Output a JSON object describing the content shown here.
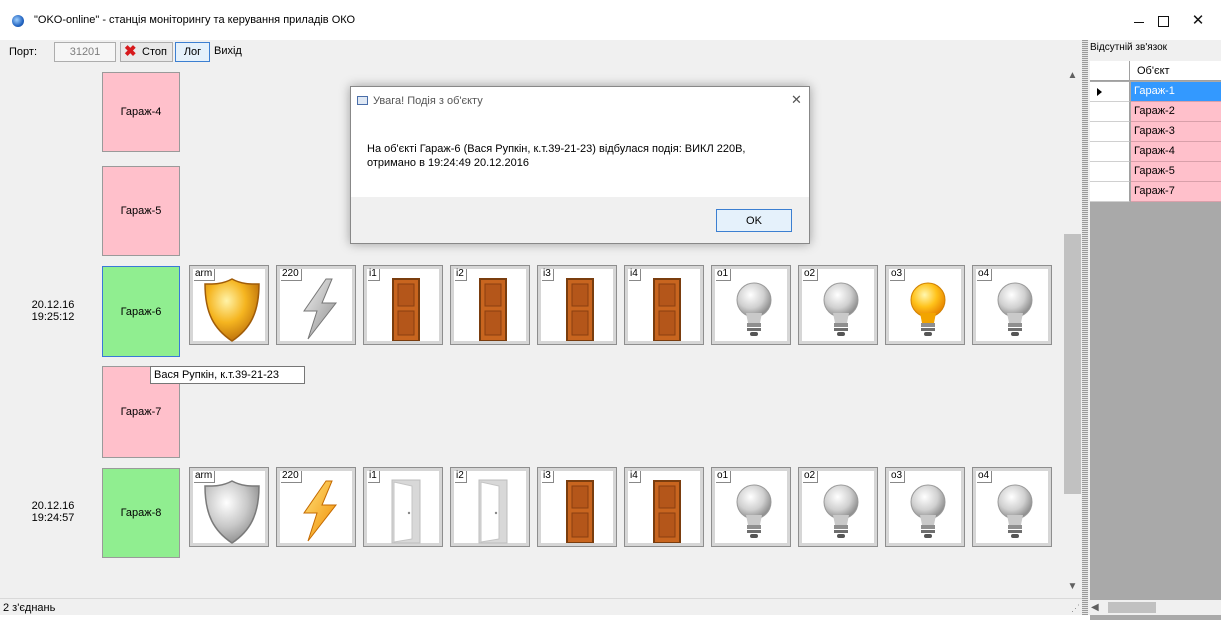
{
  "window": {
    "title": "\"OKO-online\" - станція моніторингу та керування приладів ОКО",
    "icons": {
      "app": "globe-app-icon",
      "minimize": "minimize-icon",
      "maximize": "maximize-icon",
      "close": "close-icon"
    }
  },
  "toolbar": {
    "port_label": "Порт:",
    "port_value": "31201",
    "stop_label": "Стоп",
    "log_label": "Лог",
    "exit_label": "Вихід",
    "stop_icon": "red-x-icon"
  },
  "objects": {
    "g4": {
      "name": "Гараж-4",
      "color": "#ffc0cb"
    },
    "g5": {
      "name": "Гараж-5",
      "color": "#ffc0cb"
    },
    "g6": {
      "name": "Гараж-6",
      "color": "#90ee90",
      "date": "20.12.16",
      "time": "19:25:12",
      "tooltip": "Вася Рупкін, к.т.39-21-23",
      "sensors": [
        {
          "label": "arm",
          "icon": "shield-gold-icon"
        },
        {
          "label": "220",
          "icon": "lightning-gray-icon"
        },
        {
          "label": "i1",
          "icon": "door-closed-icon"
        },
        {
          "label": "i2",
          "icon": "door-closed-icon"
        },
        {
          "label": "i3",
          "icon": "door-closed-icon"
        },
        {
          "label": "i4",
          "icon": "door-closed-icon"
        },
        {
          "label": "o1",
          "icon": "bulb-off-icon"
        },
        {
          "label": "o2",
          "icon": "bulb-off-icon"
        },
        {
          "label": "o3",
          "icon": "bulb-on-icon"
        },
        {
          "label": "o4",
          "icon": "bulb-off-icon"
        }
      ]
    },
    "g7": {
      "name": "Гараж-7",
      "color": "#ffc0cb"
    },
    "g8": {
      "name": "Гараж-8",
      "color": "#90ee90",
      "date": "20.12.16",
      "time": "19:24:57",
      "sensors": [
        {
          "label": "arm",
          "icon": "shield-gray-icon"
        },
        {
          "label": "220",
          "icon": "lightning-gold-icon"
        },
        {
          "label": "i1",
          "icon": "door-open-icon"
        },
        {
          "label": "i2",
          "icon": "door-open-icon"
        },
        {
          "label": "i3",
          "icon": "door-closed-icon"
        },
        {
          "label": "i4",
          "icon": "door-closed-icon"
        },
        {
          "label": "o1",
          "icon": "bulb-off-icon"
        },
        {
          "label": "o2",
          "icon": "bulb-off-icon"
        },
        {
          "label": "o3",
          "icon": "bulb-off-icon"
        },
        {
          "label": "o4",
          "icon": "bulb-off-icon"
        }
      ]
    }
  },
  "dialog": {
    "title": "Увага! Подія з об'єкту",
    "message": "На об'єкті Гараж-6 (Вася Рупкін, к.т.39-21-23) відбулася подія: ВИКЛ 220В, отримано в 19:24:49 20.12.2016",
    "ok_label": "OK"
  },
  "status": {
    "text": "2 з'єднань"
  },
  "right_panel": {
    "title": "Відсутній зв'язок",
    "column_header": "Об'єкт",
    "rows": [
      "Гараж-1",
      "Гараж-2",
      "Гараж-3",
      "Гараж-4",
      "Гараж-5",
      "Гараж-7"
    ],
    "selected_row": "Гараж-1"
  },
  "colors": {
    "offline": "#ffc0cb",
    "online": "#90ee90",
    "selection": "#3399ff",
    "stop_x": "#d7191c"
  }
}
